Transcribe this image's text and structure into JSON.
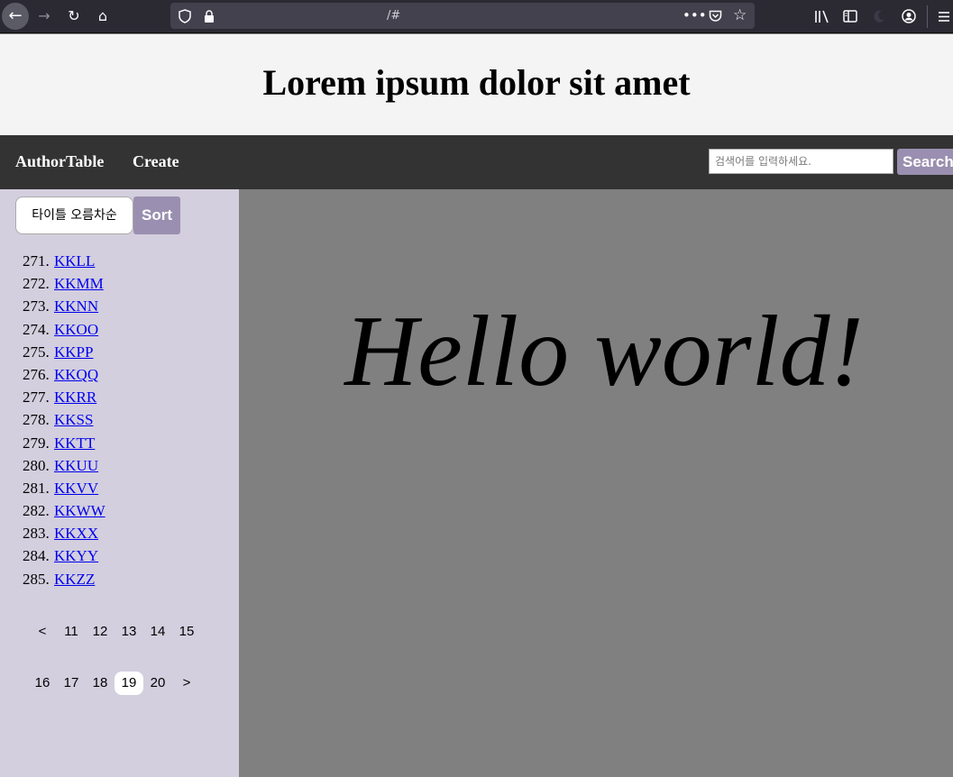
{
  "browser": {
    "url": "/#"
  },
  "header": {
    "title": "Lorem ipsum dolor sit amet"
  },
  "nav": {
    "links": [
      "AuthorTable",
      "Create"
    ],
    "search_placeholder": "검색어를 입력하세요.",
    "search_button": "Search"
  },
  "sidebar": {
    "sort_option": "타이틀 오름차순",
    "sort_button": "Sort",
    "items": [
      {
        "num": "271.",
        "label": "KKLL"
      },
      {
        "num": "272.",
        "label": "KKMM"
      },
      {
        "num": "273.",
        "label": "KKNN"
      },
      {
        "num": "274.",
        "label": "KKOO"
      },
      {
        "num": "275.",
        "label": "KKPP"
      },
      {
        "num": "276.",
        "label": "KKQQ"
      },
      {
        "num": "277.",
        "label": "KKRR"
      },
      {
        "num": "278.",
        "label": "KKSS"
      },
      {
        "num": "279.",
        "label": "KKTT"
      },
      {
        "num": "280.",
        "label": "KKUU"
      },
      {
        "num": "281.",
        "label": "KKVV"
      },
      {
        "num": "282.",
        "label": "KKWW"
      },
      {
        "num": "283.",
        "label": "KKXX"
      },
      {
        "num": "284.",
        "label": "KKYY"
      },
      {
        "num": "285.",
        "label": "KKZZ"
      }
    ],
    "pagination": {
      "row1": [
        "<",
        "11",
        "12",
        "13",
        "14",
        "15"
      ],
      "row2": [
        "16",
        "17",
        "18",
        "19",
        "20",
        ">"
      ],
      "current": "19"
    }
  },
  "main": {
    "greeting": "Hello world!"
  }
}
